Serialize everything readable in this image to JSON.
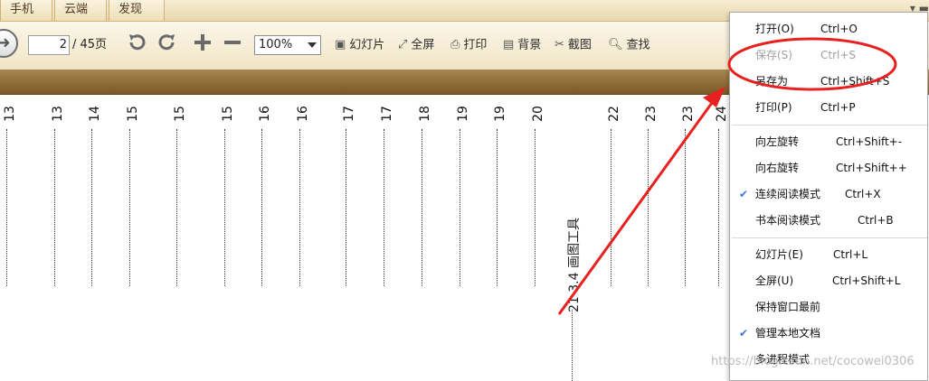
{
  "tabs": [
    {
      "label": "手机"
    },
    {
      "label": "云端"
    },
    {
      "label": "发现"
    }
  ],
  "toolbar": {
    "page_current": "2",
    "page_total": "/ 45页",
    "zoom": "100%",
    "slideshow": "幻灯片",
    "fullscreen": "全屏",
    "print": "打印",
    "background": "背景",
    "screenshot": "截图",
    "find": "查找"
  },
  "document": {
    "columns": [
      "13",
      "13",
      "14",
      "15",
      "15",
      "15",
      "16",
      "16",
      "17",
      "17",
      "18",
      "19",
      "19",
      "20",
      "21 3.4 画图工具",
      "22",
      "23",
      "23",
      "24"
    ]
  },
  "menu": {
    "items": [
      {
        "label": "打开(O)",
        "shortcut": "Ctrl+O",
        "checked": false,
        "disabled": false
      },
      {
        "label": "保存(S)",
        "shortcut": "Ctrl+S",
        "checked": false,
        "disabled": true
      },
      {
        "label": "另存为",
        "shortcut": "Ctrl+Shift+S",
        "checked": false,
        "disabled": false
      },
      {
        "label": "打印(P)",
        "shortcut": "Ctrl+P",
        "checked": false,
        "disabled": false
      },
      {
        "label": "向左旋转",
        "shortcut": "Ctrl+Shift+-",
        "checked": false,
        "disabled": false
      },
      {
        "label": "向右旋转",
        "shortcut": "Ctrl+Shift++",
        "checked": false,
        "disabled": false
      },
      {
        "label": "连续阅读模式",
        "shortcut": "Ctrl+X",
        "checked": true,
        "disabled": false
      },
      {
        "label": "书本阅读模式",
        "shortcut": "Ctrl+B",
        "checked": false,
        "disabled": false
      },
      {
        "label": "幻灯片(E)",
        "shortcut": "Ctrl+L",
        "checked": false,
        "disabled": false
      },
      {
        "label": "全屏(U)",
        "shortcut": "Ctrl+Shift+L",
        "checked": false,
        "disabled": false
      },
      {
        "label": "保持窗口最前",
        "shortcut": "",
        "checked": false,
        "disabled": false
      },
      {
        "label": "管理本地文档",
        "shortcut": "",
        "checked": true,
        "disabled": false
      },
      {
        "label": "多进程模式",
        "shortcut": "",
        "checked": false,
        "disabled": false
      }
    ]
  },
  "watermark": "https://blog.csdn.net/cocowei0306",
  "colors": {
    "annotation": "#e8201e",
    "check": "#3a7bd5"
  }
}
